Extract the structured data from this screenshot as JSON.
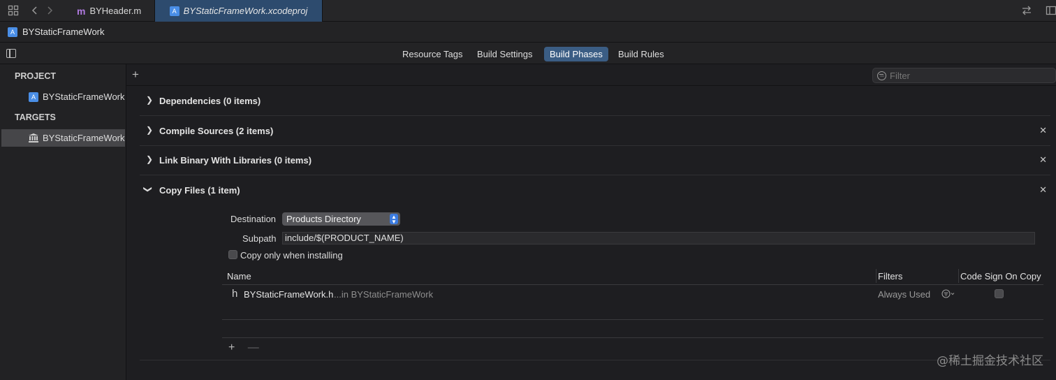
{
  "tabbar": {
    "tabs": [
      {
        "label": "BYHeader.m",
        "icon": "objc-m-icon"
      },
      {
        "label": "BYStaticFrameWork.xcodeproj",
        "icon": "xcodeproj-icon"
      }
    ]
  },
  "pathbar": {
    "label": "BYStaticFrameWork"
  },
  "editor_tabs": [
    "Resource Tags",
    "Build Settings",
    "Build Phases",
    "Build Rules"
  ],
  "editor_tabs_selected": "Build Phases",
  "sidebar": {
    "project_title": "PROJECT",
    "project_item": "BYStaticFrameWork",
    "targets_title": "TARGETS",
    "target_item": "BYStaticFrameWork"
  },
  "main": {
    "filter_placeholder": "Filter",
    "phases": [
      {
        "title": "Dependencies (0 items)",
        "expanded": false
      },
      {
        "title": "Compile Sources (2 items)",
        "expanded": false
      },
      {
        "title": "Link Binary With Libraries (0 items)",
        "expanded": false
      },
      {
        "title": "Copy Files (1 item)",
        "expanded": true
      }
    ],
    "copy_files": {
      "destination_label": "Destination",
      "destination_value": "Products Directory",
      "subpath_label": "Subpath",
      "subpath_value": "include/$(PRODUCT_NAME)",
      "copy_only_label": "Copy only when installing",
      "columns": [
        "Name",
        "Filters",
        "Code Sign On Copy"
      ],
      "rows": [
        {
          "glyph": "h",
          "name": "BYStaticFrameWork.h",
          "location": "...in BYStaticFrameWork",
          "filters": "Always Used"
        }
      ],
      "add_glyph": "+",
      "remove_glyph": "—"
    }
  },
  "watermark": "@稀土掘金技术社区",
  "colors": {
    "selected_tab": "#2d4b6e",
    "selected_segment": "#3b5d84",
    "stepper": "#3b7be0"
  }
}
